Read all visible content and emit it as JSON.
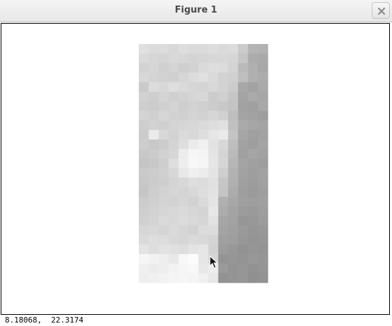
{
  "window": {
    "title": "Figure 1"
  },
  "statusbar": {
    "coords": "8.18068,  22.3174"
  },
  "icons": {
    "close": "close-icon",
    "cursor": "mouse-pointer-icon"
  },
  "image": {
    "rows": 25,
    "cols": 13,
    "grayscale_levels": [
      [
        224,
        219,
        220,
        216,
        222,
        219,
        218,
        221,
        218,
        220,
        203,
        180,
        178
      ],
      [
        218,
        214,
        212,
        217,
        215,
        212,
        213,
        215,
        216,
        214,
        198,
        172,
        170
      ],
      [
        210,
        214,
        208,
        212,
        206,
        210,
        218,
        222,
        220,
        212,
        186,
        176,
        168
      ],
      [
        216,
        212,
        210,
        208,
        214,
        220,
        224,
        218,
        210,
        208,
        190,
        176,
        172
      ],
      [
        202,
        220,
        216,
        222,
        218,
        214,
        212,
        216,
        210,
        204,
        168,
        162,
        170
      ],
      [
        210,
        206,
        212,
        208,
        210,
        214,
        216,
        204,
        208,
        198,
        164,
        170,
        166
      ],
      [
        206,
        204,
        208,
        212,
        206,
        210,
        208,
        204,
        200,
        196,
        162,
        160,
        168
      ],
      [
        212,
        208,
        214,
        210,
        208,
        212,
        210,
        214,
        208,
        190,
        164,
        162,
        158
      ],
      [
        206,
        210,
        208,
        212,
        214,
        216,
        218,
        222,
        224,
        192,
        170,
        166,
        164
      ],
      [
        204,
        234,
        216,
        210,
        218,
        216,
        222,
        230,
        234,
        196,
        166,
        160,
        162
      ],
      [
        206,
        200,
        204,
        212,
        222,
        236,
        240,
        226,
        216,
        190,
        162,
        158,
        164
      ],
      [
        200,
        204,
        210,
        214,
        236,
        246,
        244,
        228,
        212,
        186,
        160,
        166,
        162
      ],
      [
        196,
        200,
        206,
        222,
        238,
        248,
        246,
        230,
        214,
        182,
        164,
        160,
        158
      ],
      [
        202,
        204,
        208,
        216,
        232,
        240,
        236,
        228,
        206,
        178,
        162,
        158,
        162
      ],
      [
        200,
        204,
        206,
        212,
        216,
        222,
        220,
        224,
        198,
        176,
        160,
        156,
        160
      ],
      [
        198,
        206,
        210,
        214,
        212,
        216,
        222,
        226,
        196,
        172,
        158,
        154,
        158
      ],
      [
        204,
        208,
        212,
        210,
        214,
        210,
        218,
        228,
        176,
        168,
        160,
        158,
        160
      ],
      [
        206,
        210,
        214,
        216,
        218,
        214,
        212,
        232,
        172,
        164,
        156,
        154,
        158
      ],
      [
        208,
        212,
        218,
        216,
        220,
        216,
        214,
        226,
        166,
        162,
        150,
        152,
        156
      ],
      [
        214,
        216,
        212,
        218,
        214,
        210,
        220,
        220,
        164,
        160,
        154,
        150,
        152
      ],
      [
        218,
        222,
        220,
        216,
        214,
        218,
        216,
        212,
        160,
        158,
        152,
        148,
        150
      ],
      [
        228,
        222,
        226,
        224,
        222,
        228,
        230,
        210,
        156,
        152,
        146,
        150,
        148
      ],
      [
        246,
        242,
        238,
        232,
        248,
        252,
        230,
        214,
        148,
        150,
        148,
        152,
        150
      ],
      [
        240,
        236,
        238,
        242,
        246,
        248,
        232,
        236,
        154,
        148,
        150,
        146,
        148
      ],
      [
        238,
        240,
        242,
        244,
        246,
        244,
        240,
        232,
        146,
        148,
        150,
        144,
        146
      ]
    ]
  }
}
